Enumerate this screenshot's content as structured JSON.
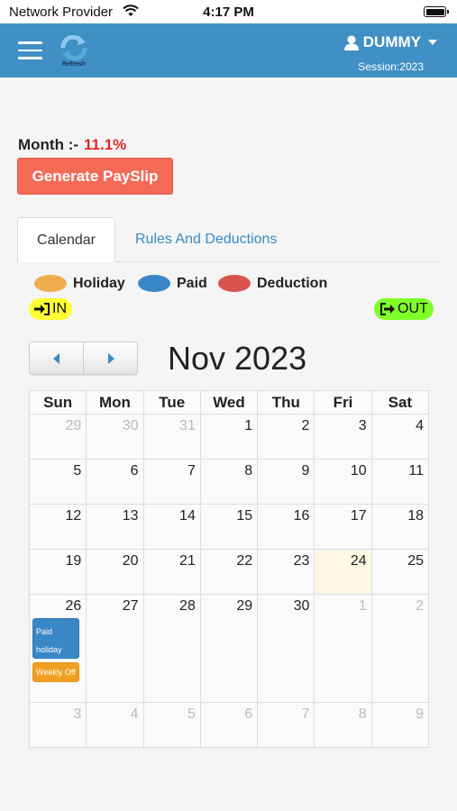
{
  "status_bar": {
    "carrier": "Network Provider",
    "time": "4:17 PM"
  },
  "header": {
    "refresh_label": "Refresh",
    "user_name": "DUMMY",
    "session": "Session:2023"
  },
  "month": {
    "label": "Month :-",
    "value": "11.1%"
  },
  "payslip_button": "Generate PaySlip",
  "tabs": [
    {
      "label": "Calendar",
      "active": true
    },
    {
      "label": "Rules And Deductions",
      "active": false
    }
  ],
  "legend": [
    {
      "label": "Holiday",
      "color": "#f0ad4e"
    },
    {
      "label": "Paid",
      "color": "#3a87c8"
    },
    {
      "label": "Deduction",
      "color": "#d9534f"
    }
  ],
  "in_label": "IN",
  "out_label": "OUT",
  "colors": {
    "header": "#4190c5",
    "in_badge": "#ffff33",
    "out_badge": "#7fff2a",
    "payslip": "#f36a57"
  },
  "calendar": {
    "title": "Nov 2023",
    "weekdays": [
      "Sun",
      "Mon",
      "Tue",
      "Wed",
      "Thu",
      "Fri",
      "Sat"
    ],
    "weeks": [
      [
        "29",
        "30",
        "31",
        "1",
        "2",
        "3",
        "4"
      ],
      [
        "5",
        "6",
        "7",
        "8",
        "9",
        "10",
        "11"
      ],
      [
        "12",
        "13",
        "14",
        "15",
        "16",
        "17",
        "18"
      ],
      [
        "19",
        "20",
        "21",
        "22",
        "23",
        "24",
        "25"
      ],
      [
        "26",
        "27",
        "28",
        "29",
        "30",
        "1",
        "2"
      ],
      [
        "3",
        "4",
        "5",
        "6",
        "7",
        "8",
        "9"
      ]
    ],
    "today": "24",
    "events": [
      {
        "day": "26",
        "text": "Paid holiday",
        "color": "#3a87c8"
      },
      {
        "day": "26",
        "text": "Weekly Off",
        "color": "#f0a020"
      }
    ]
  }
}
